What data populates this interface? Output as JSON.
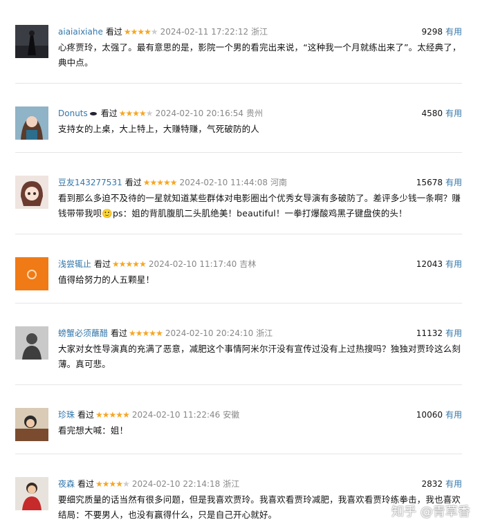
{
  "comments": [
    {
      "user": "aiaiaixiahe",
      "seen": "看过",
      "stars": "★★★★",
      "stars_off": "★",
      "time": "2024-02-11 17:22:12",
      "loc": "浙江",
      "count": "9298",
      "useful": "有用",
      "text": "心疼贾玲，太强了。最有意思的是，影院一个男的看完出来说，“这种我一个月就练出来了”。太经典了，典中点。"
    },
    {
      "user": "Donuts",
      "seen": "看过",
      "stars": "★★★★",
      "stars_off": "★",
      "time": "2024-02-10 20:16:54",
      "loc": "贵州",
      "count": "4580",
      "useful": "有用",
      "text": "支持女的上桌，大上特上，大赚特赚，气死破防的人"
    },
    {
      "user": "豆友143277531",
      "seen": "看过",
      "stars": "★★★★★",
      "stars_off": "",
      "time": "2024-02-10 11:44:08",
      "loc": "河南",
      "count": "15678",
      "useful": "有用",
      "text": "看到那么多迫不及待的一星就知道某些群体对电影圈出个优秀女导演有多破防了。差评多少钱一条啊？赚钱带带我呗🙂ps：姐的背肌腹肌二头肌绝美！beautiful！一拳打爆酸鸡黑子键盘侠的头！"
    },
    {
      "user": "浅尝辄止",
      "seen": "看过",
      "stars": "★★★★★",
      "stars_off": "",
      "time": "2024-02-10 11:17:40",
      "loc": "吉林",
      "count": "12043",
      "useful": "有用",
      "text": "值得给努力的人五颗星！"
    },
    {
      "user": "螃蟹必须蘸醋",
      "seen": "看过",
      "stars": "★★★★★",
      "stars_off": "",
      "time": "2024-02-10 20:24:10",
      "loc": "浙江",
      "count": "11132",
      "useful": "有用",
      "text": "大家对女性导演真的充满了恶意，减肥这个事情阿米尔汗没有宣传过没有上过热搜吗？独独对贾玲这么刻薄。真可悲。"
    },
    {
      "user": "珍珠",
      "seen": "看过",
      "stars": "★★★★★",
      "stars_off": "",
      "time": "2024-02-10 11:22:46",
      "loc": "安徽",
      "count": "10060",
      "useful": "有用",
      "text": "看完想大喊：姐！"
    },
    {
      "user": "夜森",
      "seen": "看过",
      "stars": "★★★★",
      "stars_off": "★",
      "time": "2024-02-10 22:14:18",
      "loc": "浙江",
      "count": "2832",
      "useful": "有用",
      "text": "要细究质量的话当然有很多问题，但是我喜欢贾玲。我喜欢看贾玲减肥，我喜欢看贾玲练拳击，我也喜欢结局：不要男人，也没有赢得什么，只是自己开心就好。"
    }
  ],
  "watermark": "知乎 @青草香",
  "colors": {
    "link": "#3377aa",
    "star": "#f5a623",
    "meta": "#888888"
  }
}
